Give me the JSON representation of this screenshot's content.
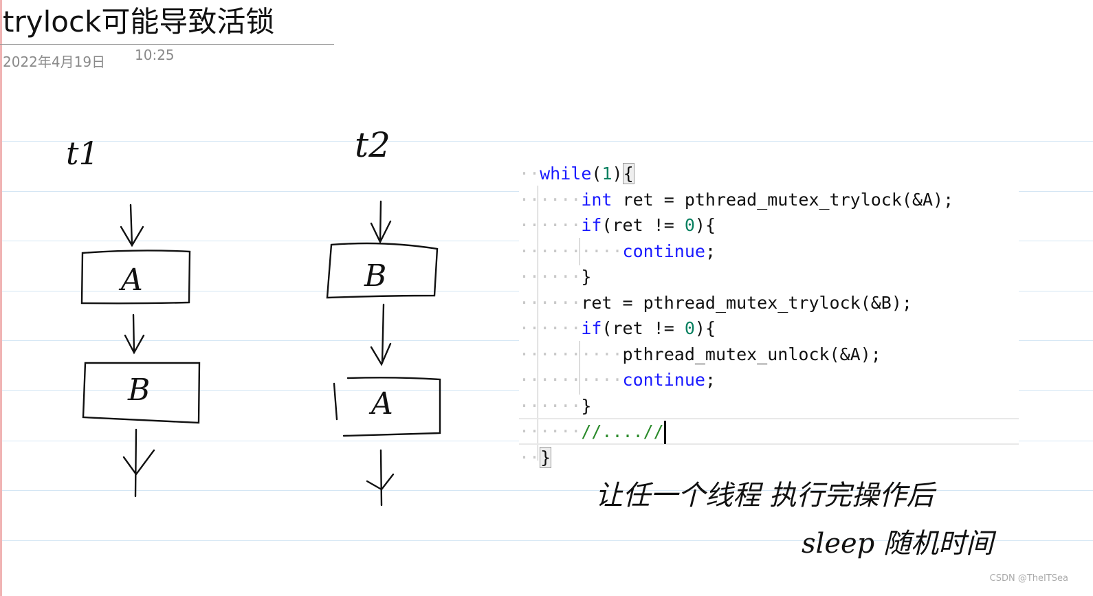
{
  "page": {
    "title": "trylock可能导致活锁",
    "date": "2022年4月19日",
    "time": "10:25"
  },
  "diagram": {
    "thread1": {
      "label": "t1",
      "boxes": [
        "A",
        "B"
      ]
    },
    "thread2": {
      "label": "t2",
      "boxes": [
        "B",
        "A"
      ]
    }
  },
  "code": {
    "lines": [
      {
        "indent": "  ",
        "parts": [
          [
            "kw",
            "while"
          ],
          [
            "",
            "("
          ],
          [
            "num",
            "1"
          ],
          [
            "",
            ")"
          ],
          [
            "brace",
            "{"
          ]
        ]
      },
      {
        "indent": "      ",
        "parts": [
          [
            "kw",
            "int"
          ],
          [
            "",
            " ret = pthread_mutex_trylock(&A);"
          ]
        ]
      },
      {
        "indent": "      ",
        "parts": [
          [
            "kw",
            "if"
          ],
          [
            "",
            "(ret != "
          ],
          [
            "num",
            "0"
          ],
          [
            "",
            "){"
          ]
        ]
      },
      {
        "indent": "          ",
        "parts": [
          [
            "kw",
            "continue"
          ],
          [
            "",
            ";"
          ]
        ]
      },
      {
        "indent": "      ",
        "parts": [
          [
            "",
            "}"
          ]
        ]
      },
      {
        "indent": "      ",
        "parts": [
          [
            "",
            "ret = pthread_mutex_trylock(&B);"
          ]
        ]
      },
      {
        "indent": "      ",
        "parts": [
          [
            "kw",
            "if"
          ],
          [
            "",
            "(ret != "
          ],
          [
            "num",
            "0"
          ],
          [
            "",
            "){"
          ]
        ]
      },
      {
        "indent": "          ",
        "parts": [
          [
            "",
            "pthread_mutex_unlock(&A);"
          ]
        ]
      },
      {
        "indent": "          ",
        "parts": [
          [
            "kw",
            "continue"
          ],
          [
            "",
            ";"
          ]
        ]
      },
      {
        "indent": "      ",
        "parts": [
          [
            "",
            "}"
          ]
        ]
      },
      {
        "indent": "      ",
        "parts": [
          [
            "cm",
            "//....//"
          ]
        ]
      },
      {
        "indent": "  ",
        "parts": [
          [
            "brace",
            "}"
          ]
        ]
      }
    ]
  },
  "annotation": {
    "line1": "让任一个线程 执行完操作后",
    "line2": "sleep 随机时间"
  },
  "watermark": "CSDN @TheITSea",
  "colors": {
    "keyword": "#1a1aff",
    "number": "#0a8060",
    "comment": "#2a8a2a",
    "rule": "#d4e6f4",
    "margin": "#f0b4b4"
  }
}
